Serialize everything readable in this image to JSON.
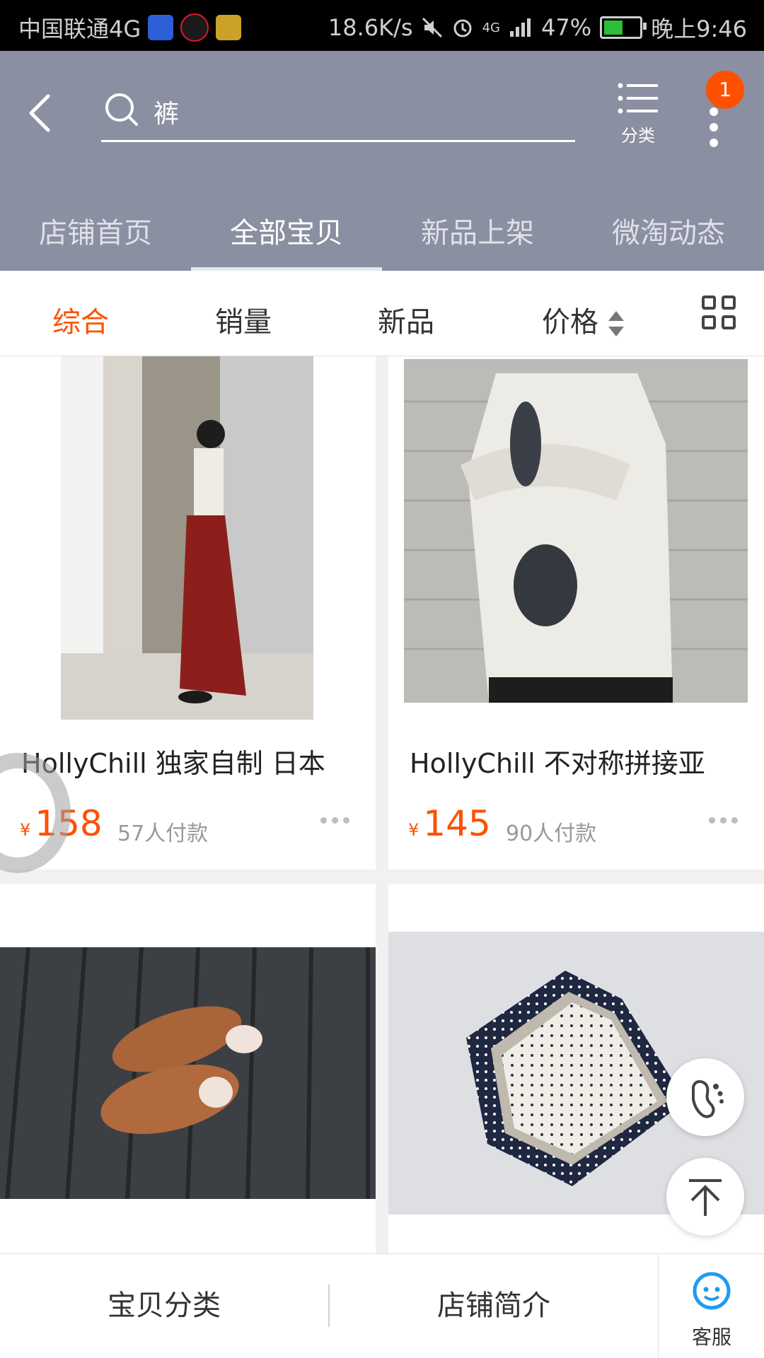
{
  "status_bar": {
    "carrier": "中国联通4G",
    "speed": "18.6K/s",
    "signal": "4G",
    "battery": "47%",
    "time": "晚上9:46"
  },
  "header": {
    "search_value": "裤",
    "category_label": "分类",
    "notification_count": "1",
    "tabs": [
      "店铺首页",
      "全部宝贝",
      "新品上架",
      "微淘动态"
    ]
  },
  "sort_bar": {
    "options": [
      "综合",
      "销量",
      "新品",
      "价格"
    ]
  },
  "products": [
    {
      "title": "HollyChill 独家自制 日本",
      "currency": "¥",
      "price": "158",
      "sold": "57人付款"
    },
    {
      "title": "HollyChill 不对称拼接亚",
      "currency": "¥",
      "price": "145",
      "sold": "90人付款"
    }
  ],
  "bottom_bar": {
    "category": "宝贝分类",
    "shop_intro": "店铺简介",
    "service": "客服"
  },
  "colors": {
    "header_bg": "#8a8fa1",
    "accent": "#ff5000"
  }
}
